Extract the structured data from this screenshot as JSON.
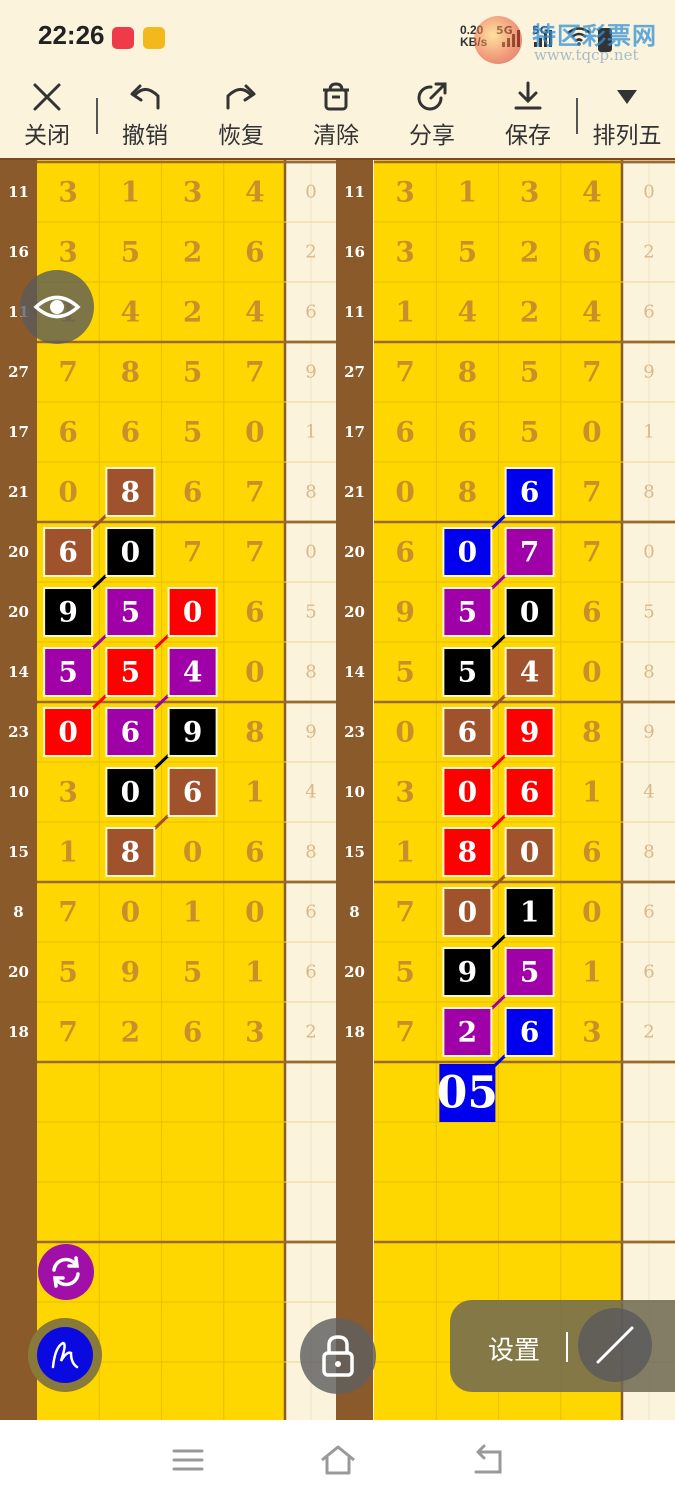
{
  "status_bar": {
    "time": "22:26",
    "net_speed_value": "0.20",
    "net_speed_unit": "KB/s",
    "signal_1": "5G",
    "signal_2": "5G",
    "icons": [
      "red-app-icon",
      "yellow-app-icon",
      "signal-icon",
      "signal-icon",
      "wifi-icon",
      "battery-icon"
    ]
  },
  "watermark": {
    "name": "特区彩票网",
    "url": "www.tqcp.net"
  },
  "toolbar": {
    "items": [
      {
        "label": "关闭",
        "icon": "close-icon"
      },
      {
        "label": "撤销",
        "icon": "undo-icon"
      },
      {
        "label": "恢复",
        "icon": "redo-icon"
      },
      {
        "label": "清除",
        "icon": "trash-icon"
      },
      {
        "label": "分享",
        "icon": "share-icon"
      },
      {
        "label": "保存",
        "icon": "download-icon"
      },
      {
        "label": "排列五",
        "icon": "dropdown-triangle-icon"
      }
    ]
  },
  "colors": {
    "board_yellow": "#ffd700",
    "sum_column": "#8b5a2b",
    "tail_column": "#fbf3dc",
    "mark_brown": "#a0522d",
    "mark_black": "#000000",
    "mark_purple": "#a000a8",
    "mark_red": "#ff0000",
    "mark_blue": "#0000ee"
  },
  "grid": {
    "sums": [
      "11",
      "16",
      "11",
      "27",
      "17",
      "21",
      "20",
      "20",
      "14",
      "23",
      "10",
      "15",
      "8",
      "20",
      "18"
    ],
    "digits": [
      [
        "3",
        "1",
        "3",
        "4"
      ],
      [
        "3",
        "5",
        "2",
        "6"
      ],
      [
        "1",
        "4",
        "2",
        "4"
      ],
      [
        "7",
        "8",
        "5",
        "7"
      ],
      [
        "6",
        "6",
        "5",
        "0"
      ],
      [
        "0",
        "8",
        "6",
        "7"
      ],
      [
        "6",
        "0",
        "7",
        "7"
      ],
      [
        "9",
        "5",
        "0",
        "6"
      ],
      [
        "5",
        "5",
        "4",
        "0"
      ],
      [
        "0",
        "6",
        "9",
        "8"
      ],
      [
        "3",
        "0",
        "6",
        "1"
      ],
      [
        "1",
        "8",
        "0",
        "6"
      ],
      [
        "7",
        "0",
        "1",
        "0"
      ],
      [
        "5",
        "9",
        "5",
        "1"
      ],
      [
        "7",
        "2",
        "6",
        "3"
      ]
    ],
    "tails": [
      "0",
      "2",
      "6",
      "9",
      "1",
      "8",
      "0",
      "5",
      "8",
      "9",
      "4",
      "8",
      "6",
      "6",
      "2"
    ]
  },
  "left_panel": {
    "marks": [
      {
        "row": 5,
        "col": 1,
        "color": "brown"
      },
      {
        "row": 6,
        "col": 0,
        "color": "brown"
      },
      {
        "row": 6,
        "col": 1,
        "color": "black"
      },
      {
        "row": 7,
        "col": 0,
        "color": "black"
      },
      {
        "row": 7,
        "col": 1,
        "color": "purple"
      },
      {
        "row": 7,
        "col": 2,
        "color": "red"
      },
      {
        "row": 8,
        "col": 0,
        "color": "purple"
      },
      {
        "row": 8,
        "col": 1,
        "color": "red"
      },
      {
        "row": 8,
        "col": 2,
        "color": "purple"
      },
      {
        "row": 9,
        "col": 0,
        "color": "red"
      },
      {
        "row": 9,
        "col": 1,
        "color": "purple"
      },
      {
        "row": 9,
        "col": 2,
        "color": "black"
      },
      {
        "row": 10,
        "col": 1,
        "color": "black"
      },
      {
        "row": 10,
        "col": 2,
        "color": "brown"
      },
      {
        "row": 11,
        "col": 1,
        "color": "brown"
      }
    ],
    "lines": [
      {
        "from": [
          5,
          1
        ],
        "to": [
          6,
          0
        ],
        "color": "brown"
      },
      {
        "from": [
          6,
          1
        ],
        "to": [
          7,
          0
        ],
        "color": "black"
      },
      {
        "from": [
          7,
          1
        ],
        "to": [
          8,
          0
        ],
        "color": "purple"
      },
      {
        "from": [
          8,
          1
        ],
        "to": [
          9,
          0
        ],
        "color": "red"
      },
      {
        "from": [
          7,
          2
        ],
        "to": [
          8,
          1
        ],
        "color": "red"
      },
      {
        "from": [
          8,
          2
        ],
        "to": [
          9,
          1
        ],
        "color": "purple"
      },
      {
        "from": [
          9,
          2
        ],
        "to": [
          10,
          1
        ],
        "color": "black"
      },
      {
        "from": [
          10,
          2
        ],
        "to": [
          11,
          1
        ],
        "color": "brown"
      }
    ]
  },
  "right_panel": {
    "marks": [
      {
        "row": 5,
        "col": 2,
        "color": "blue"
      },
      {
        "row": 6,
        "col": 1,
        "color": "blue"
      },
      {
        "row": 6,
        "col": 2,
        "color": "purple"
      },
      {
        "row": 7,
        "col": 1,
        "color": "purple"
      },
      {
        "row": 7,
        "col": 2,
        "color": "black"
      },
      {
        "row": 8,
        "col": 1,
        "color": "black"
      },
      {
        "row": 8,
        "col": 2,
        "color": "brown"
      },
      {
        "row": 9,
        "col": 1,
        "color": "brown"
      },
      {
        "row": 9,
        "col": 2,
        "color": "red"
      },
      {
        "row": 10,
        "col": 1,
        "color": "red"
      },
      {
        "row": 10,
        "col": 2,
        "color": "red"
      },
      {
        "row": 11,
        "col": 1,
        "color": "red"
      },
      {
        "row": 11,
        "col": 2,
        "color": "brown"
      },
      {
        "row": 12,
        "col": 1,
        "color": "brown"
      },
      {
        "row": 12,
        "col": 2,
        "color": "black"
      },
      {
        "row": 13,
        "col": 1,
        "color": "black"
      },
      {
        "row": 13,
        "col": 2,
        "color": "purple"
      },
      {
        "row": 14,
        "col": 1,
        "color": "purple"
      },
      {
        "row": 14,
        "col": 2,
        "color": "blue"
      }
    ],
    "lines": [
      {
        "from": [
          5,
          2
        ],
        "to": [
          6,
          1
        ],
        "color": "blue"
      },
      {
        "from": [
          6,
          2
        ],
        "to": [
          7,
          1
        ],
        "color": "purple"
      },
      {
        "from": [
          7,
          2
        ],
        "to": [
          8,
          1
        ],
        "color": "black"
      },
      {
        "from": [
          8,
          2
        ],
        "to": [
          9,
          1
        ],
        "color": "brown"
      },
      {
        "from": [
          9,
          2
        ],
        "to": [
          10,
          1
        ],
        "color": "red"
      },
      {
        "from": [
          10,
          2
        ],
        "to": [
          11,
          1
        ],
        "color": "red"
      },
      {
        "from": [
          11,
          2
        ],
        "to": [
          12,
          1
        ],
        "color": "brown"
      },
      {
        "from": [
          12,
          2
        ],
        "to": [
          13,
          1
        ],
        "color": "black"
      },
      {
        "from": [
          13,
          2
        ],
        "to": [
          14,
          1
        ],
        "color": "purple"
      },
      {
        "from": [
          14,
          2
        ],
        "to": [
          15,
          1
        ],
        "color": "blue"
      }
    ],
    "prediction": {
      "text": "05",
      "row": 15,
      "col": 1,
      "color": "blue"
    }
  },
  "controls": {
    "settings_label": "设置",
    "icons": [
      "eye-icon",
      "refresh-icon",
      "draw-icon",
      "lock-icon",
      "pen-icon"
    ]
  },
  "nav_bar": {
    "icons": [
      "menu-icon",
      "home-icon",
      "back-icon"
    ]
  }
}
